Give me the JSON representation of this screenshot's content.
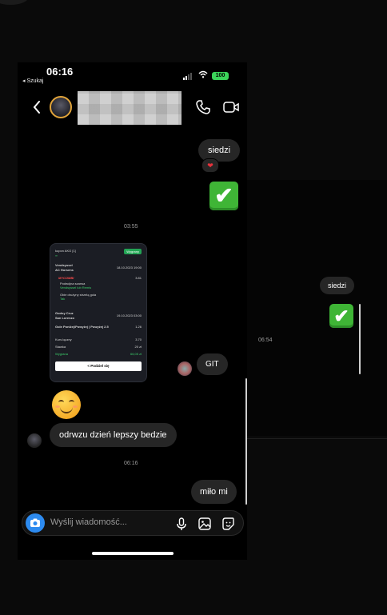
{
  "status": {
    "time": "06:16",
    "back_label": "◂ Szukaj",
    "battery": "100"
  },
  "messages": {
    "m1": "siedzi",
    "heart": "❤",
    "check": "✔",
    "time1": "03:55",
    "git": "GIT",
    "m_other": "odrwzu dzień lepszy bedzie",
    "time2": "06:16",
    "m_last": "miło mi"
  },
  "background": {
    "msg": "siedzi",
    "check": "✔",
    "time": "06:54"
  },
  "shared_coupon": {
    "header": "kupon AKO [1]",
    "tag": "Wygrany",
    "match1": "Vendsyssel",
    "match1b": "AC Horsens",
    "match1_date": "18.10.2023 19:00",
    "mycombi": "MYCOMBI",
    "mycombi_odds": "3.81",
    "pick1": "Podwójna szansa",
    "pick1b": "Vendsyssel lub Remis",
    "pick2": "Obie drużyny strzelą gola",
    "pick2b": "Tak",
    "match2": "Godoy Cruz",
    "match2b": "San Lorenzo",
    "match2_date": "19.10.2023 03:00",
    "pick3": "Gole Poniżej/Powyżej | Powyżej 2.5",
    "pick3_odds": "1.26",
    "total_odds_label": "Kurs łączny",
    "total_odds": "3.70",
    "stake_label": "Stawka",
    "stake": "20 zł",
    "win_label": "Wygrana",
    "win": "66,05 zł",
    "share_button": "< Podziel się"
  },
  "compose": {
    "placeholder": "Wyślij wiadomość..."
  },
  "colors": {
    "bubble": "#262626",
    "check_green": "#3fb536",
    "battery": "#3bd45a",
    "camera": "#2d8bf0"
  }
}
